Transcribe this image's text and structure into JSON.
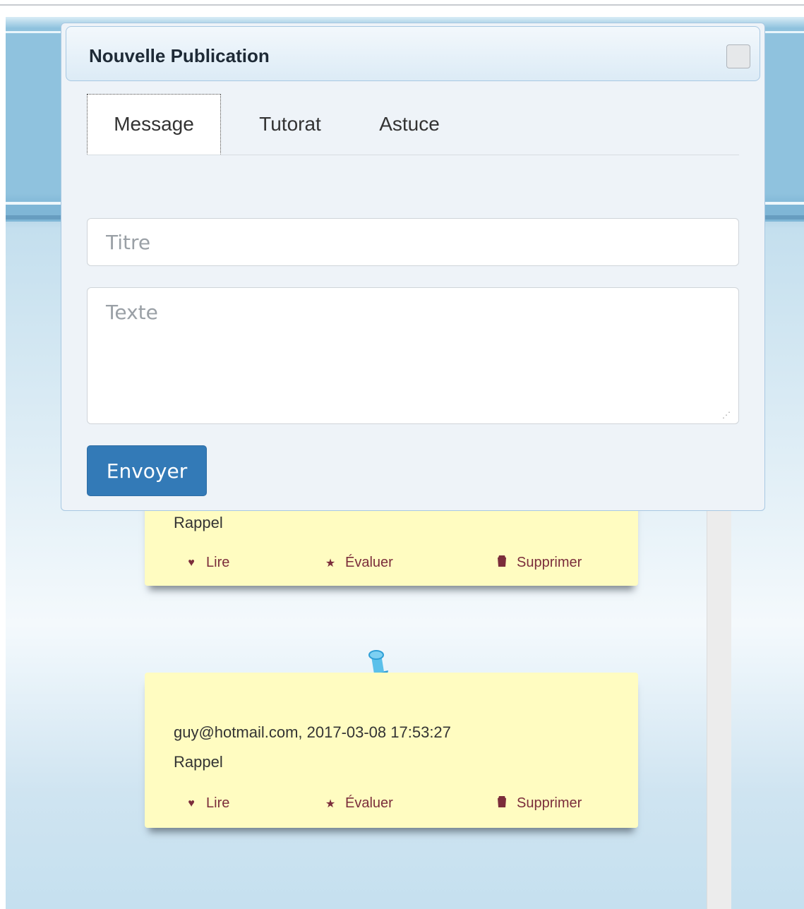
{
  "modal": {
    "title": "Nouvelle Publication",
    "tabs": [
      {
        "label": "Message",
        "active": true
      },
      {
        "label": "Tutorat",
        "active": false
      },
      {
        "label": "Astuce",
        "active": false
      }
    ],
    "title_placeholder": "Titre",
    "text_placeholder": "Texte",
    "submit_label": "Envoyer"
  },
  "notes": [
    {
      "meta": "",
      "title": "Rappel",
      "actions": {
        "read": "Lire",
        "rate": "Évaluer",
        "delete": "Supprimer"
      }
    },
    {
      "meta": "guy@hotmail.com, 2017-03-08 17:53:27",
      "title": "Rappel",
      "actions": {
        "read": "Lire",
        "rate": "Évaluer",
        "delete": "Supprimer"
      }
    }
  ],
  "icons": {
    "read": "heart-icon",
    "rate": "star-icon",
    "delete": "trash-icon",
    "pin": "pushpin-icon"
  },
  "colors": {
    "accent": "#337ab7",
    "note_bg": "#fffcc1",
    "action_text": "#7b2d3b"
  }
}
